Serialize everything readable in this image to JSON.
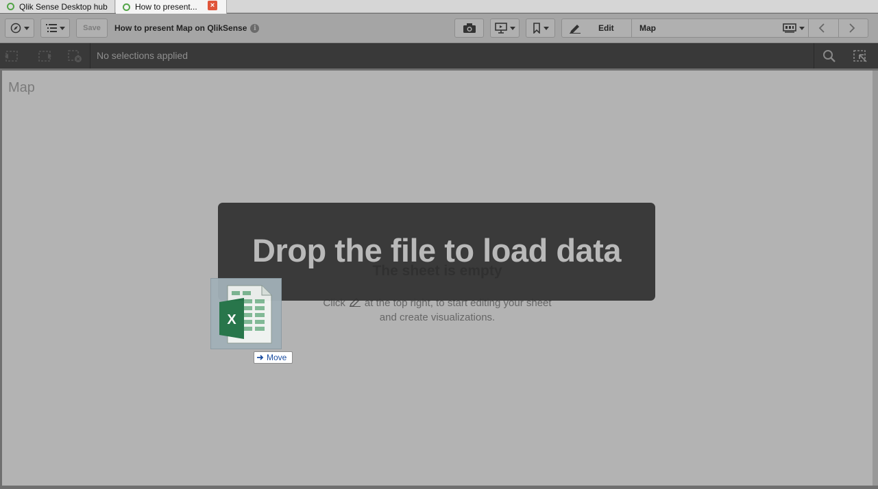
{
  "tabs": [
    {
      "label": "Qlik Sense Desktop hub",
      "active": false
    },
    {
      "label": "How to present...",
      "active": true,
      "close_glyph": "×"
    }
  ],
  "toolbar": {
    "save_label": "Save",
    "app_title": "How to present Map on QlikSense",
    "info_glyph": "i",
    "edit_label": "Edit",
    "sheet_name": "Map"
  },
  "selections": {
    "status_text": "No selections applied"
  },
  "sheet": {
    "title": "Map",
    "empty_title": "The sheet is empty",
    "hint_before": "Click",
    "hint_after": "at the top right, to start editing your sheet",
    "hint_line2": "and create visualizations."
  },
  "drop_overlay": {
    "message": "Drop the file to load data"
  },
  "drag": {
    "file_icon": "excel-file-icon",
    "excel_letter": "X",
    "tooltip": "Move"
  },
  "colors": {
    "toolbar_bg": "#a5a5a5",
    "selbar_bg": "#393939",
    "sheet_bg": "#b3b3b3",
    "excel_green": "#217346",
    "qlik_green": "#52a447",
    "close_red": "#e0553a"
  }
}
